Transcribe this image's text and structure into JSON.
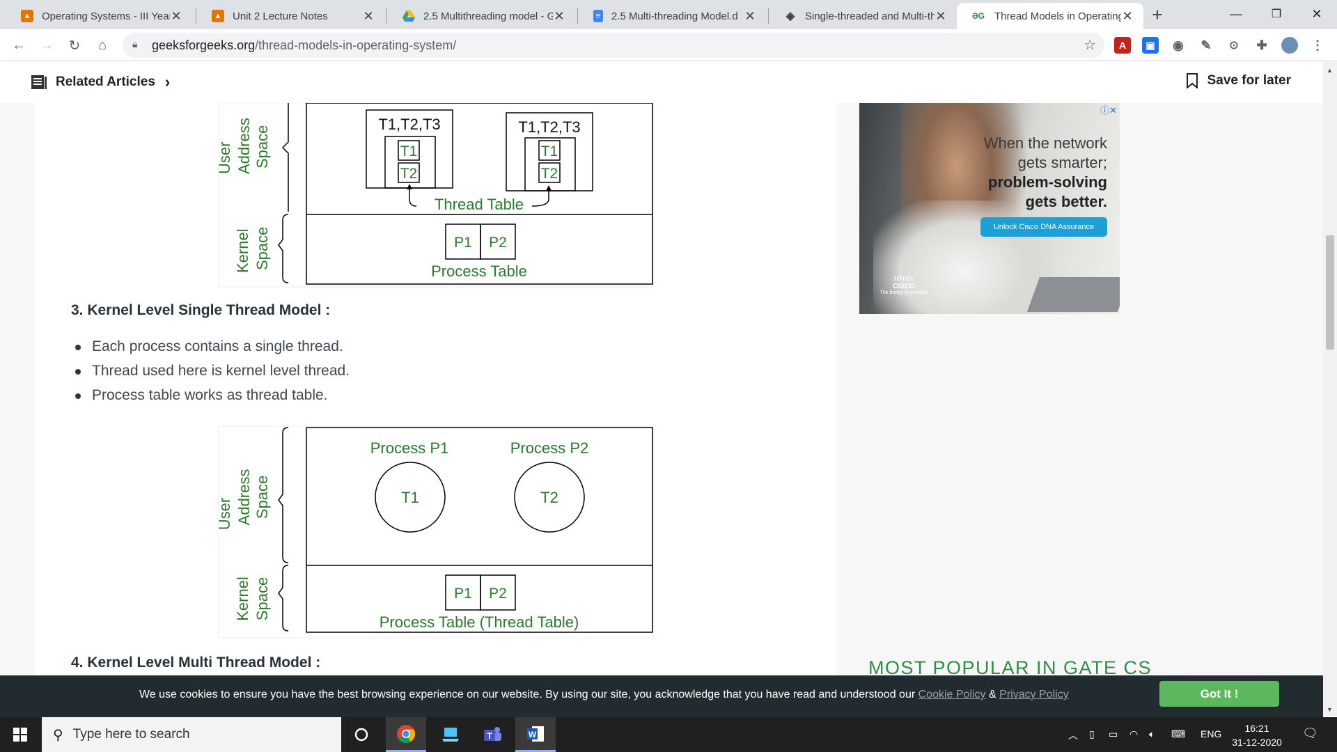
{
  "tabs": [
    {
      "title": "Operating Systems - III Year I",
      "favicon": "orange-doc-icon",
      "color": "#e37400"
    },
    {
      "title": "Unit 2 Lecture Notes",
      "favicon": "orange-doc-icon",
      "color": "#e37400"
    },
    {
      "title": "2.5 Multithreading model - G",
      "favicon": "drive-icon",
      "color": "#34a853"
    },
    {
      "title": "2.5 Multi-threading Model.d",
      "favicon": "docs-icon",
      "color": "#4285f4"
    },
    {
      "title": "Single-threaded and Multi-th",
      "favicon": "diamond-icon",
      "color": "#5f6368"
    },
    {
      "title": "Thread Models in Operating",
      "favicon": "gfg-icon",
      "color": "#2f8d46"
    }
  ],
  "address": {
    "domain": "geeksforgeeks.org",
    "path": "/thread-models-in-operating-system/"
  },
  "subheader": {
    "related": "Related Articles",
    "save": "Save for later"
  },
  "figure1": {
    "user_label": "User Address Space",
    "user_lines": [
      "User",
      "Address",
      "Space"
    ],
    "kernel_lines": [
      "Kernel",
      "Space"
    ],
    "group_label": "T1,T2,T3",
    "t1": "T1",
    "t2": "T2",
    "thread_table": "Thread Table",
    "p1": "P1",
    "p2": "P2",
    "process_table": "Process Table"
  },
  "section3": {
    "heading": "3. Kernel Level Single Thread Model :",
    "bullets": [
      "Each process contains a single thread.",
      "Thread used here is kernel level thread.",
      "Process table works as thread table."
    ]
  },
  "figure2": {
    "user_lines": [
      "User",
      "Address",
      "Space"
    ],
    "kernel_lines": [
      "Kernel",
      "Space"
    ],
    "proc1": "Process P1",
    "proc2": "Process P2",
    "t1": "T1",
    "t2": "T2",
    "p1": "P1",
    "p2": "P2",
    "table": "Process Table (Thread Table)"
  },
  "section4": {
    "heading": "4. Kernel Level Multi Thread Model :"
  },
  "ad": {
    "line1": "When the network gets smarter;",
    "line2": "problem-solving gets better.",
    "cta": "Unlock Cisco DNA Assurance",
    "brand": "CISCO",
    "brand_tag": "The bridge to possible"
  },
  "sidebar": {
    "popular": "MOST POPULAR IN GATE CS"
  },
  "cookie": {
    "text": "We use cookies to ensure you have the best browsing experience on our website. By using our site, you acknowledge that you have read and understood our",
    "cookie_link": "Cookie Policy",
    "amp": "&",
    "privacy_link": "Privacy Policy",
    "button": "Got It !"
  },
  "taskbar": {
    "search_placeholder": "Type here to search",
    "lang": "ENG",
    "time": "16:21",
    "date": "31-12-2020"
  },
  "colors": {
    "gfg_green": "#2f8d46",
    "cookie_bg": "#222b30",
    "got_it": "#5cb85c"
  }
}
